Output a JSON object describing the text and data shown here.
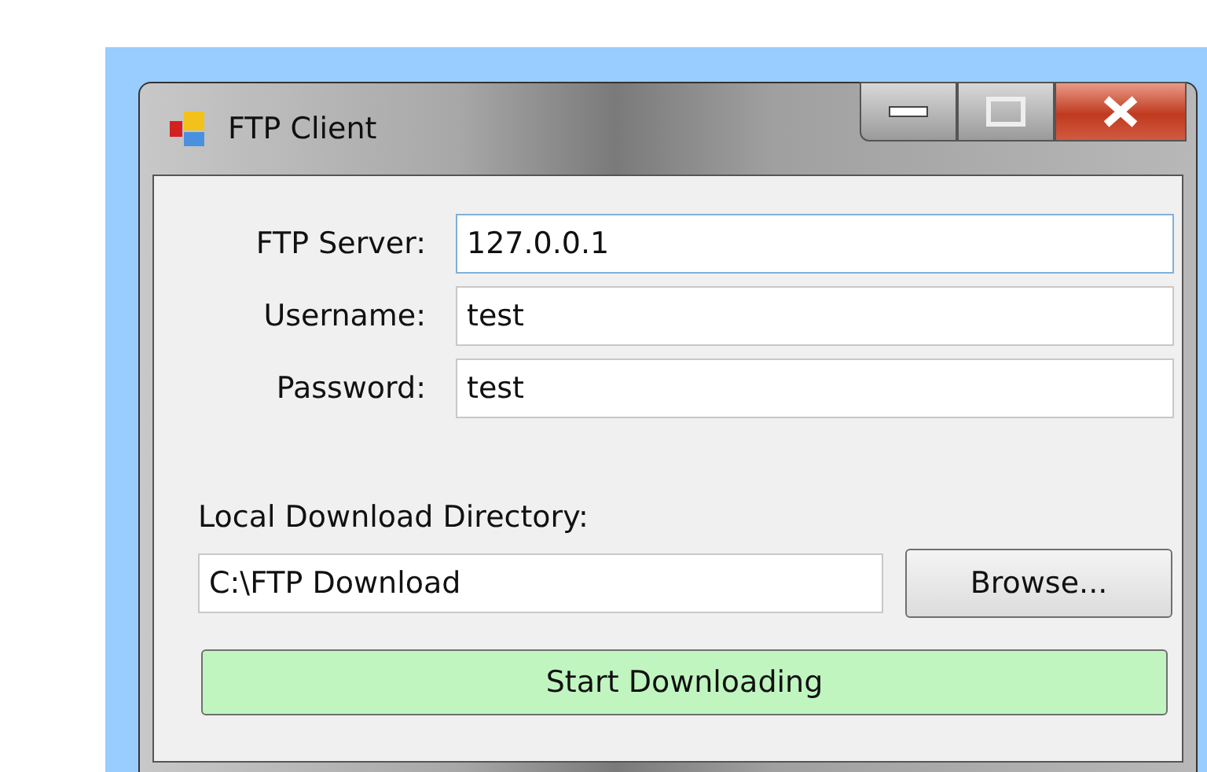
{
  "window": {
    "title": "FTP Client"
  },
  "fields": [
    {
      "label": "FTP Server:",
      "value": "127.0.0.1",
      "focused": true
    },
    {
      "label": "Username:",
      "value": "test",
      "focused": false
    },
    {
      "label": "Password:",
      "value": "test",
      "focused": false
    }
  ],
  "directory": {
    "label": "Local Download Directory:",
    "value": "C:\\FTP Download"
  },
  "buttons": {
    "browse": "Browse...",
    "start": "Start Downloading"
  }
}
